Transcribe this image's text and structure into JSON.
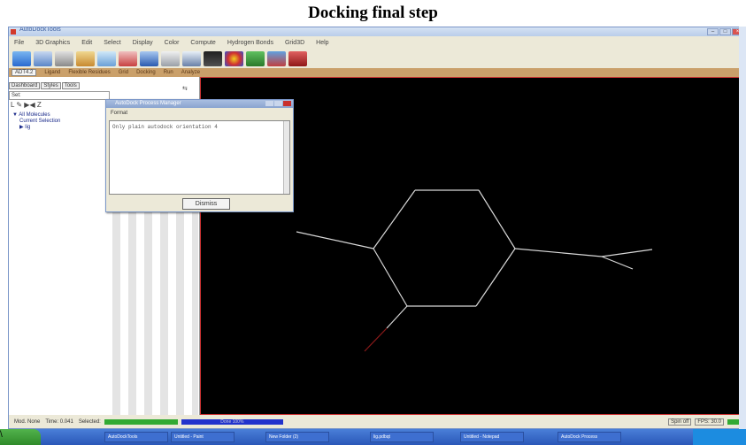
{
  "caption": "Docking final step",
  "window": {
    "title": "AutoDockTools",
    "menu": [
      "File",
      "3D Graphics",
      "Edit",
      "Select",
      "Display",
      "Color",
      "Compute",
      "Hydrogen Bonds",
      "Grid3D",
      "Help"
    ],
    "tabs": [
      "ADT4.2",
      "Ligand",
      "Flexible Residues",
      "Grid",
      "Docking",
      "Run",
      "Analyze"
    ]
  },
  "left_panel": {
    "tabs": [
      "Dashboard",
      "Styles",
      "Tools"
    ],
    "set_label": "Set:",
    "icon_row": "L ✎ ▶◀ Z",
    "tree": [
      "All Molecules",
      "Current Selection",
      "lig"
    ]
  },
  "dialog": {
    "title": "AutoDock Process Manager",
    "menu": "Format",
    "text": "Only plain autodock orientation 4",
    "button": "Dismiss"
  },
  "status_bar": {
    "mod": "Mod. None",
    "time": "Time: 0.041",
    "selected": "Selected:",
    "progress": "Progress",
    "done": "Done 100%",
    "spin": "Spin off",
    "fps": "FPS: 30.0"
  },
  "taskbar": {
    "items": [
      "AutoDockTools",
      "Untitled - Paint",
      "New Folder (2)",
      "lig.pdbqt",
      "Untitled - Notepad",
      "AutoDock Process"
    ]
  },
  "colors": {
    "viewer_bg": "#000000",
    "bond": "#d8d8d8",
    "oxygen": "#8b1a1a",
    "menu_tabs": "#caa06a"
  }
}
